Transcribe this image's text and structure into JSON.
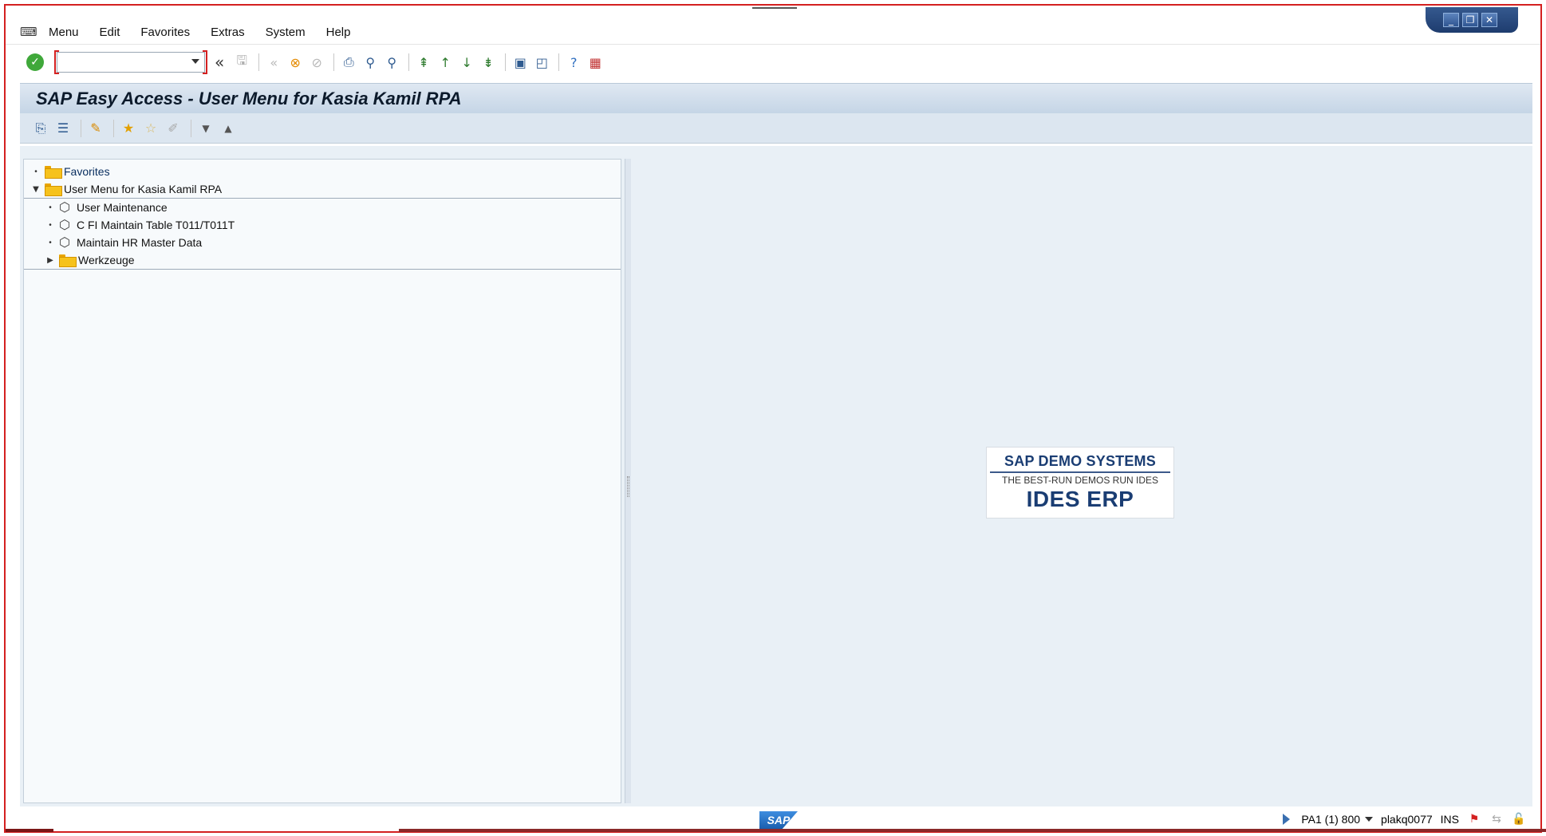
{
  "menubar": {
    "items": [
      "Menu",
      "Edit",
      "Favorites",
      "Extras",
      "System",
      "Help"
    ]
  },
  "system_toolbar": {
    "command_field_value": "",
    "double_arrow": "«"
  },
  "title": "SAP Easy Access  -  User Menu for Kasia Kamil RPA",
  "tree": {
    "favorites": "Favorites",
    "user_menu": "User Menu for Kasia Kamil RPA",
    "items": [
      {
        "label": "User Maintenance",
        "type": "transaction"
      },
      {
        "label": "C FI Maintain Table T011/T011T",
        "type": "transaction"
      },
      {
        "label": "Maintain HR Master Data",
        "type": "transaction"
      },
      {
        "label": "Werkzeuge",
        "type": "folder"
      }
    ]
  },
  "logo": {
    "line1": "SAP DEMO SYSTEMS",
    "line2": "THE BEST-RUN DEMOS RUN IDES",
    "line3": "IDES ERP"
  },
  "statusbar": {
    "sap_logo": "SAP",
    "system": "PA1 (1) 800",
    "user": "plakq0077",
    "mode": "INS"
  },
  "colors": {
    "frame_border": "#d42020",
    "title_bg": "#c5d5e6",
    "content_bg": "#e9f0f6",
    "folder": "#f6c21c"
  }
}
